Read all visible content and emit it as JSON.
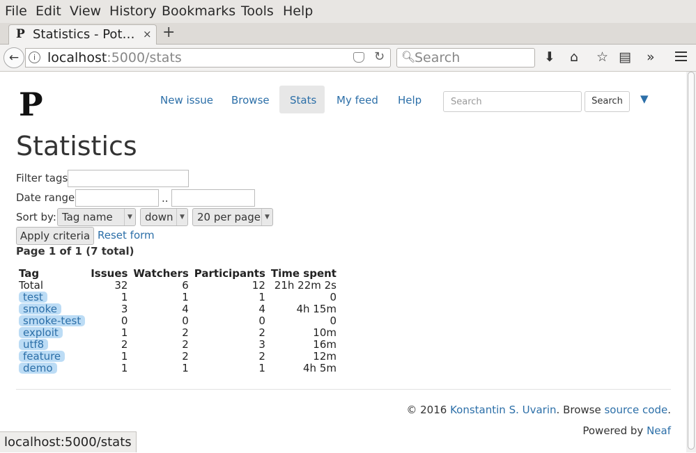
{
  "browser": {
    "menu": [
      "File",
      "Edit",
      "View",
      "History",
      "Bookmarks",
      "Tools",
      "Help"
    ],
    "tab": {
      "favicon": "Ρ",
      "title": "Statistics - Pot…",
      "close": "×",
      "new_tab": "+"
    },
    "url": {
      "host": "localhost",
      "path": ":5000/stats"
    },
    "search_placeholder": "Search",
    "status_url": "localhost:5000/stats"
  },
  "site": {
    "logo": "Ρ",
    "nav": [
      "New issue",
      "Browse",
      "Stats",
      "My feed",
      "Help"
    ],
    "search_placeholder": "Search",
    "search_button": "Search",
    "user_icon": "👤"
  },
  "page": {
    "title": "Statistics",
    "filter_tags_label": "Filter tags",
    "date_range_label": "Date range",
    "date_sep": "..",
    "sort_label": "Sort by:",
    "sort_field": "Tag name",
    "sort_dir": "down",
    "per_page": "20 per page",
    "apply": "Apply criteria",
    "reset": "Reset form",
    "page_info": "Page 1 of 1 (7 total)"
  },
  "table": {
    "headers": [
      "Tag",
      "Issues",
      "Watchers",
      "Participants",
      "Time spent"
    ],
    "total": [
      "Total",
      "32",
      "6",
      "12",
      "21h 22m 2s"
    ],
    "rows": [
      [
        "test",
        "1",
        "1",
        "1",
        "0"
      ],
      [
        "smoke",
        "3",
        "4",
        "4",
        "4h 15m"
      ],
      [
        "smoke-test",
        "0",
        "0",
        "0",
        "0"
      ],
      [
        "exploit",
        "1",
        "2",
        "2",
        "10m"
      ],
      [
        "utf8",
        "2",
        "2",
        "3",
        "16m"
      ],
      [
        "feature",
        "1",
        "2",
        "2",
        "12m"
      ],
      [
        "demo",
        "1",
        "1",
        "1",
        "4h 5m"
      ]
    ]
  },
  "footer": {
    "copyright": "© 2016 ",
    "author": "Konstantin S. Uvarin",
    "browse_text": ". Browse ",
    "source_link": "source code",
    "period": ".",
    "powered_text": "Powered by ",
    "powered_link": "Neaf"
  },
  "colors": {
    "link": "#2c6fa8",
    "tag_bg": "#bcdcf5",
    "active_nav_bg": "#e7e7e7"
  }
}
